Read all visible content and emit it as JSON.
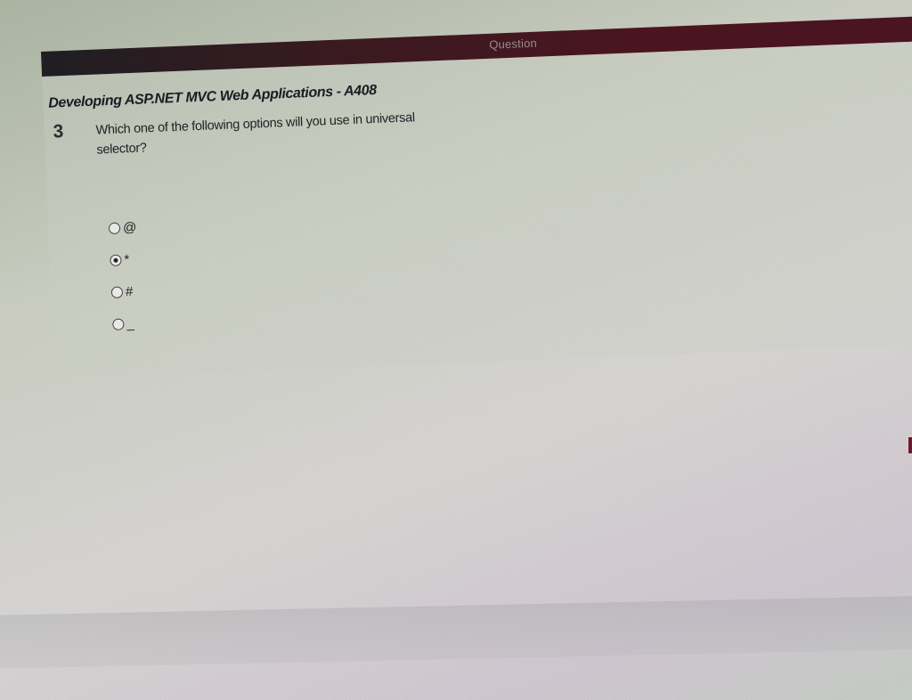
{
  "header": {
    "title": "Question"
  },
  "course": {
    "title": "Developing ASP.NET MVC Web Applications - A408"
  },
  "question": {
    "number": "3",
    "text": "Which one of the following options will you use in universal selector?"
  },
  "options": [
    {
      "label": "@",
      "selected": false
    },
    {
      "label": "*",
      "selected": true
    },
    {
      "label": "#",
      "selected": false
    },
    {
      "label": "_",
      "selected": false
    }
  ],
  "colors": {
    "header_bar": "#4b1520",
    "header_text": "#9c8a90",
    "text": "#1f2024"
  }
}
